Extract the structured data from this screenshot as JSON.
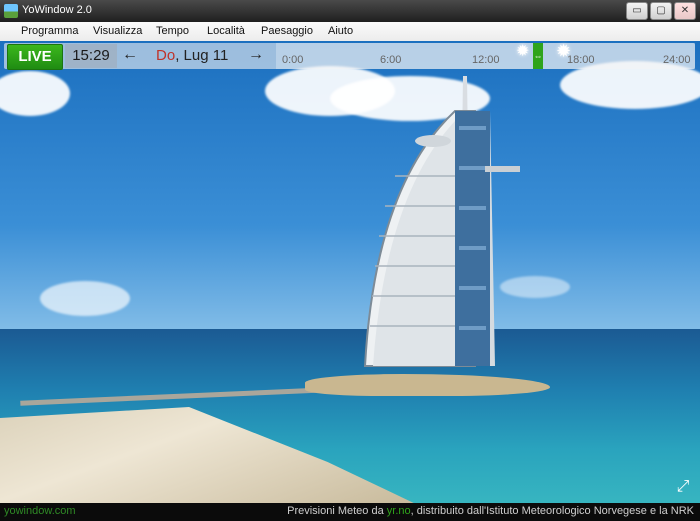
{
  "window": {
    "title": "YoWindow 2.0"
  },
  "menu": [
    "Programma",
    "Visualizza",
    "Tempo",
    "Località",
    "Paesaggio",
    "Aiuto"
  ],
  "toolbar": {
    "live_label": "LIVE",
    "time": "15:29",
    "prev_icon": "←",
    "next_icon": "→",
    "date_day": "Do",
    "date_rest": ", Lug 11"
  },
  "timeline": {
    "ticks": [
      "0:00",
      "6:00",
      "12:00",
      "18:00",
      "24:00"
    ],
    "slider_glyph": "⇔",
    "weather_icons": [
      "sun-cloud-icon",
      "sun-icon"
    ]
  },
  "statusbar": {
    "site": "yowindow.com",
    "credits_prefix": "Previsioni Meteo da ",
    "credits_link": "yr.no",
    "credits_suffix": ", distribuito dall'Istituto Meteorologico Norvegese e la NRK"
  },
  "colors": {
    "live_green": "#1f8c12",
    "day_red": "#c0332a",
    "status_link": "#2fa41b"
  }
}
